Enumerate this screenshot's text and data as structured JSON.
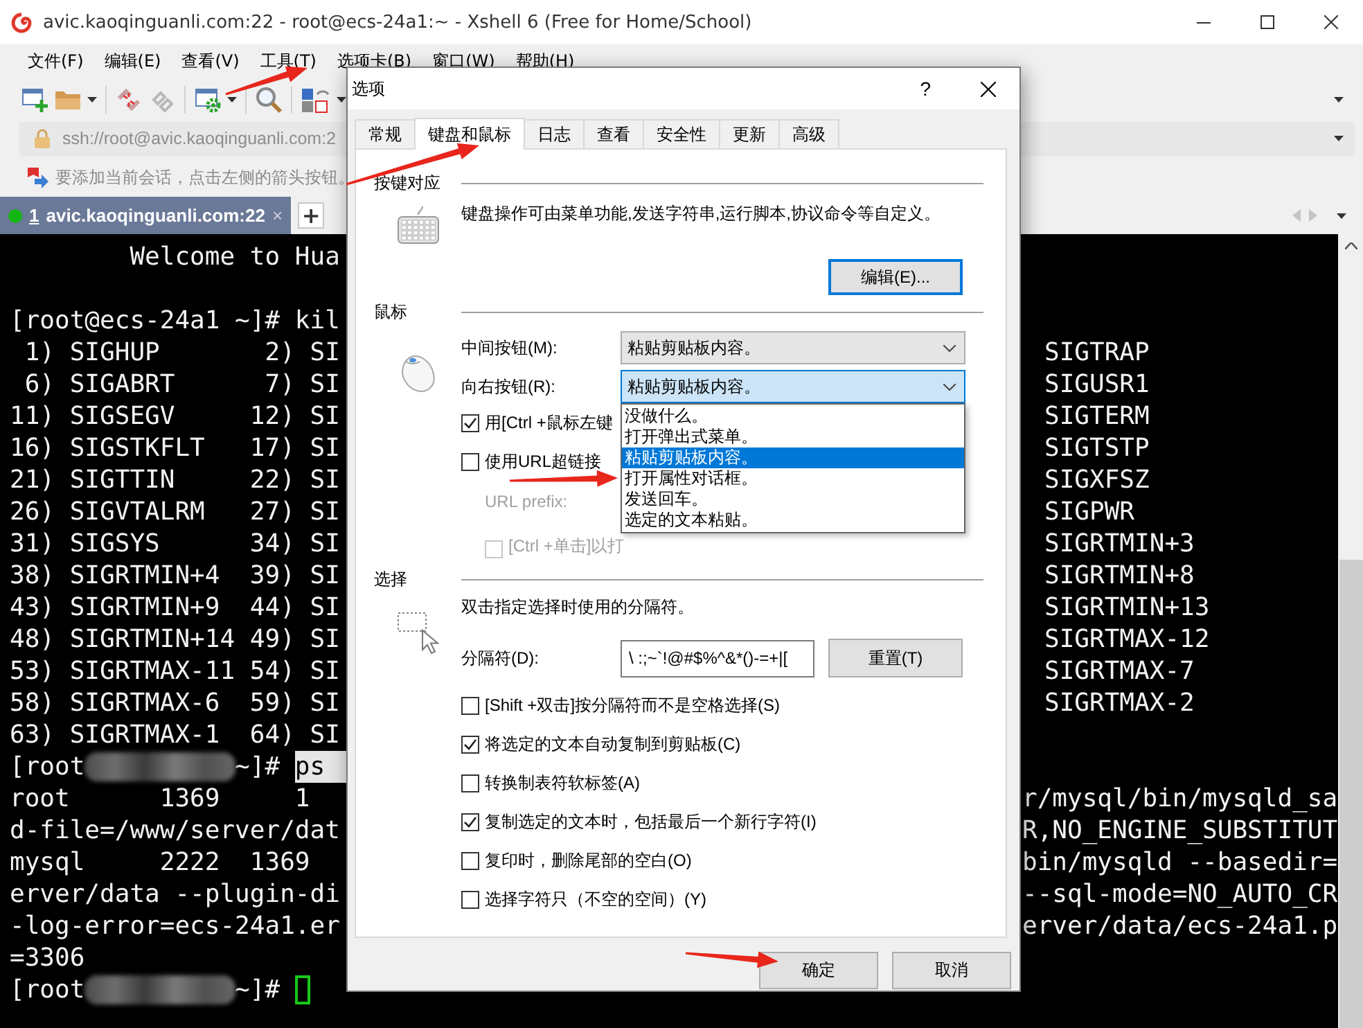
{
  "window": {
    "title": "avic.kaoqinguanli.com:22 - root@ecs-24a1:~ - Xshell 6 (Free for Home/School)"
  },
  "menu": [
    "文件(F)",
    "编辑(E)",
    "查看(V)",
    "工具(T)",
    "选项卡(B)",
    "窗口(W)",
    "帮助(H)"
  ],
  "address_bar": {
    "value": "ssh://root@avic.kaoqinguanli.com:2"
  },
  "hint_bar": {
    "text": "要添加当前会话，点击左侧的箭头按钮。"
  },
  "session_tabs": [
    {
      "number": "1",
      "label": "avic.kaoqinguanli.com:22",
      "close": "×",
      "selected": true,
      "connected": true
    }
  ],
  "new_tab_button": "+",
  "terminal": {
    "lines": [
      {
        "kind": "output",
        "text": "        Welcome to Hua"
      },
      {
        "kind": "blank"
      },
      {
        "kind": "output",
        "text": "[root@ecs-24a1 ~]# kil"
      },
      {
        "kind": "signals",
        "text": " 1) SIGHUP       2) SI",
        "right": "SIGTRAP"
      },
      {
        "kind": "signals",
        "text": " 6) SIGABRT      7) SI",
        "right": "SIGUSR1"
      },
      {
        "kind": "signals",
        "text": "11) SIGSEGV     12) SI",
        "right": "SIGTERM"
      },
      {
        "kind": "signals",
        "text": "16) SIGSTKFLT   17) SI",
        "right": "SIGTSTP"
      },
      {
        "kind": "signals",
        "text": "21) SIGTTIN     22) SI",
        "right": "SIGXFSZ"
      },
      {
        "kind": "signals",
        "text": "26) SIGVTALRM   27) SI",
        "right": "SIGPWR"
      },
      {
        "kind": "signals",
        "text": "31) SIGSYS      34) SI",
        "right": "SIGRTMIN+3"
      },
      {
        "kind": "signals",
        "text": "38) SIGRTMIN+4  39) SI",
        "right": "SIGRTMIN+8"
      },
      {
        "kind": "signals",
        "text": "43) SIGRTMIN+9  44) SI",
        "right": "SIGRTMIN+13"
      },
      {
        "kind": "signals",
        "text": "48) SIGRTMIN+14 49) SI",
        "right": "SIGRTMAX-12"
      },
      {
        "kind": "signals",
        "text": "53) SIGRTMAX-11 54) SI",
        "right": "SIGRTMAX-7"
      },
      {
        "kind": "signals",
        "text": "58) SIGRTMAX-6  59) SI",
        "right": "SIGRTMAX-2"
      },
      {
        "kind": "signals",
        "text": "63) SIGRTMAX-1  64) SI"
      },
      {
        "kind": "output",
        "segments": [
          {
            "kind": "text",
            "text": "[root"
          },
          {
            "kind": "redacted"
          },
          {
            "kind": "text",
            "text": "~]#"
          },
          {
            "kind": "selected",
            "text": "ps"
          }
        ]
      },
      {
        "kind": "output",
        "text": "root      1369     1",
        "right": "r/mysql/bin/mysqld_sa"
      },
      {
        "kind": "output",
        "text": "d-file=/www/server/dat",
        "right": "R,NO_ENGINE_SUBSTITUT"
      },
      {
        "kind": "output",
        "text": "mysql     2222  1369",
        "right": "bin/mysqld --basedir="
      },
      {
        "kind": "output",
        "text": "erver/data --plugin-di",
        "right": "--sql-mode=NO_AUTO_CR"
      },
      {
        "kind": "output",
        "text": "-log-error=ecs-24a1.er",
        "right": "erver/data/ecs-24a1.p"
      },
      {
        "kind": "output",
        "text": "=3306"
      },
      {
        "kind": "output",
        "segments": [
          {
            "kind": "text",
            "text": "[root"
          },
          {
            "kind": "redacted"
          },
          {
            "kind": "text",
            "text": "~]#"
          },
          {
            "kind": "cursor"
          }
        ]
      }
    ]
  },
  "dialog": {
    "title": "选项",
    "help": "?",
    "tabs": [
      {
        "label": "常规",
        "selected": false
      },
      {
        "label": "键盘和鼠标",
        "selected": true
      },
      {
        "label": "日志",
        "selected": false
      },
      {
        "label": "查看",
        "selected": false
      },
      {
        "label": "安全性",
        "selected": false
      },
      {
        "label": "更新",
        "selected": false
      },
      {
        "label": "高级",
        "selected": false
      }
    ],
    "key_mapping": {
      "heading": "按键对应",
      "description": "键盘操作可由菜单功能,发送字符串,运行脚本,协议命令等自定义。",
      "edit_button": {
        "label": "编辑(E)...",
        "focused": true
      }
    },
    "mouse": {
      "heading": "鼠标",
      "buttons": [
        {
          "label": "中间按钮(M):",
          "value": "粘贴剪贴板内容。",
          "expanded": false
        },
        {
          "label": "向右按钮(R):",
          "value": "粘贴剪贴板内容。",
          "expanded": true,
          "options": [
            {
              "label": "没做什么。",
              "selected": false
            },
            {
              "label": "打开弹出式菜单。",
              "selected": false
            },
            {
              "label": "粘贴剪贴板内容。",
              "selected": true
            },
            {
              "label": "打开属性对话框。",
              "selected": false
            },
            {
              "label": "发送回车。",
              "selected": false
            },
            {
              "label": "选定的文本粘贴。",
              "selected": false
            }
          ]
        }
      ],
      "options": [
        {
          "label": "用[Ctrl +鼠标左键",
          "checked": true,
          "disabled": false
        },
        {
          "label": "使用URL超链接",
          "checked": false,
          "disabled": false,
          "children": [
            {
              "kind": "label",
              "label": "URL prefix:",
              "disabled": true
            },
            {
              "kind": "checkbox",
              "label": "[Ctrl +单击]以打",
              "checked": false,
              "disabled": true
            }
          ]
        }
      ]
    },
    "selection": {
      "heading": "选择",
      "description": "双击指定选择时使用的分隔符。",
      "delimiter": {
        "label": "分隔符(D):",
        "value": "\\ :;~`!@#$%^&*()-=+|[",
        "reset_button": "重置(T)"
      },
      "options": [
        {
          "label": "[Shift +双击]按分隔符而不是空格选择(S)",
          "checked": false
        },
        {
          "label": "将选定的文本自动复制到剪贴板(C)",
          "checked": true
        },
        {
          "label": "转换制表符软标签(A)",
          "checked": false
        },
        {
          "label": "复制选定的文本时，包括最后一个新行字符(I)",
          "checked": true
        },
        {
          "label": "复印时，删除尾部的空白(O)",
          "checked": false
        },
        {
          "label": "选择字符只（不空的空间）(Y)",
          "checked": false
        }
      ]
    },
    "buttons": [
      "确定",
      "取消"
    ]
  }
}
